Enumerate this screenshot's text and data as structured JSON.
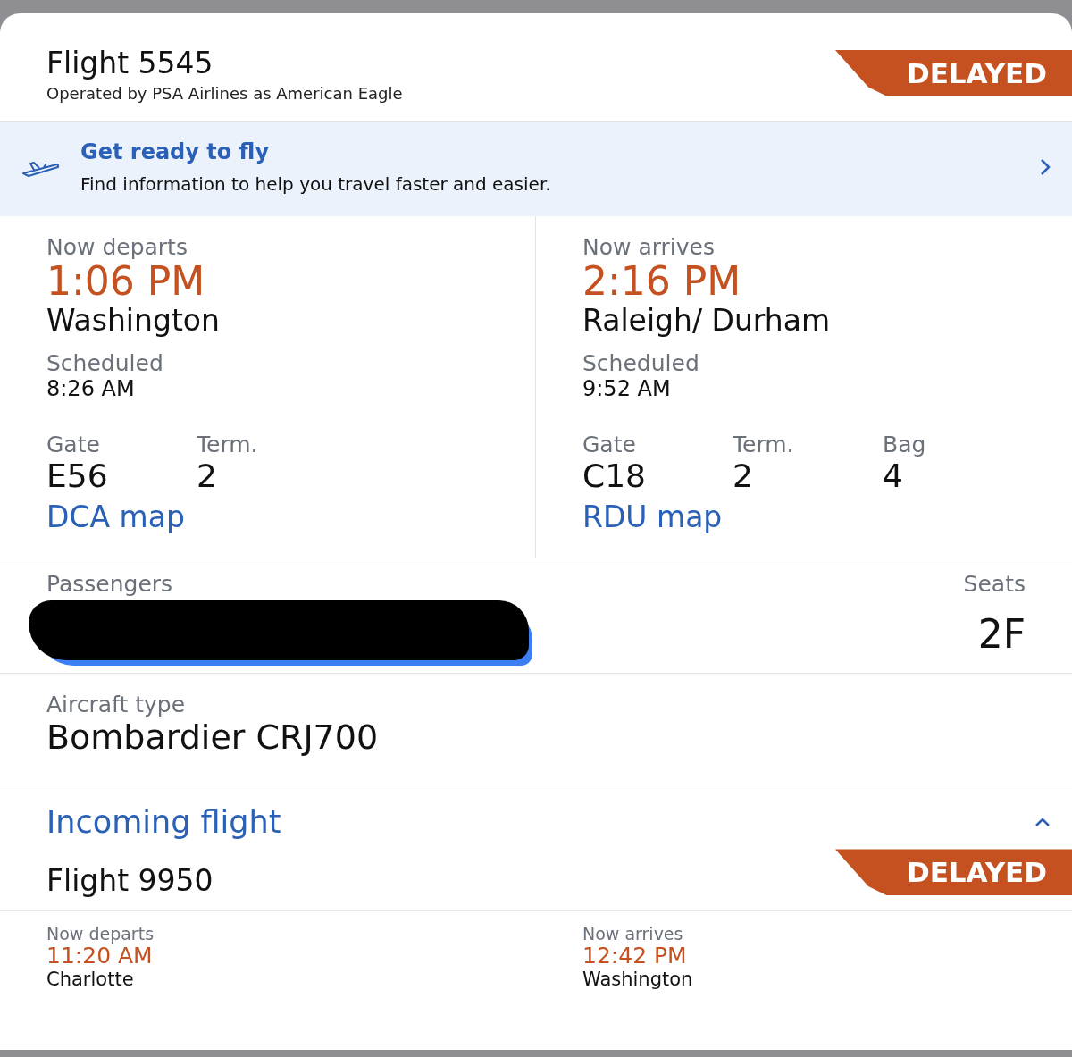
{
  "flight": {
    "title": "Flight 5545",
    "operator": "Operated by PSA Airlines as American Eagle",
    "status": {
      "kind": "delayed",
      "label": "DELAYED"
    }
  },
  "banner": {
    "title": "Get ready to fly",
    "text": "Find information to help you travel faster and easier."
  },
  "departure": {
    "label": "Now departs",
    "time": "1:06 PM",
    "city": "Washington",
    "scheduled_label": "Scheduled",
    "scheduled": "8:26 AM",
    "facts": [
      {
        "label": "Gate",
        "value": "E56"
      },
      {
        "label": "Term.",
        "value": "2"
      }
    ],
    "map_link": "DCA map"
  },
  "arrival": {
    "label": "Now arrives",
    "time": "2:16 PM",
    "city": "Raleigh/ Durham",
    "scheduled_label": "Scheduled",
    "scheduled": "9:52 AM",
    "facts": [
      {
        "label": "Gate",
        "value": "C18"
      },
      {
        "label": "Term.",
        "value": "2"
      },
      {
        "label": "Bag",
        "value": "4"
      }
    ],
    "map_link": "RDU map"
  },
  "passengers": {
    "label": "Passengers",
    "redacted": true,
    "seats_label": "Seats",
    "seat": "2F"
  },
  "aircraft": {
    "label": "Aircraft type",
    "value": "Bombardier CRJ700"
  },
  "incoming": {
    "title": "Incoming flight",
    "expanded": true,
    "flight": "Flight 9950",
    "status": {
      "kind": "delayed",
      "label": "DELAYED"
    },
    "departure": {
      "label": "Now departs",
      "time": "11:20 AM",
      "city": "Charlotte"
    },
    "arrival": {
      "label": "Now arrives",
      "time": "12:42 PM",
      "city": "Washington"
    }
  }
}
